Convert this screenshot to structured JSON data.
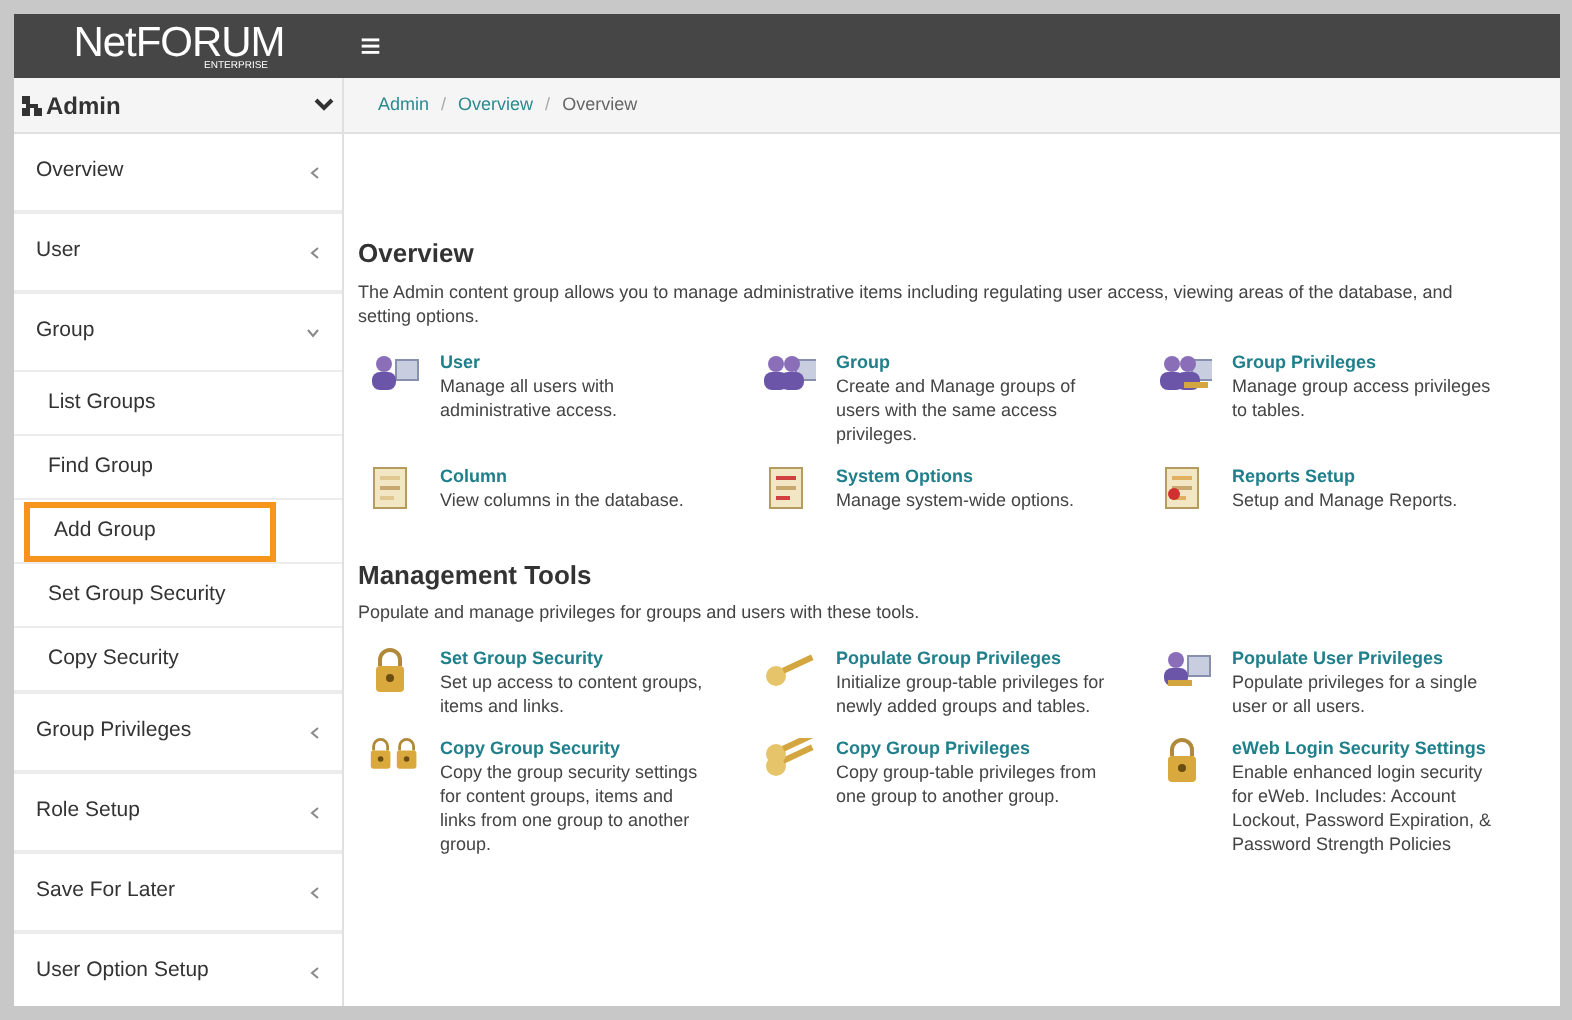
{
  "header": {
    "logo": "NetFORUM",
    "logo_sub": "ENTERPRISE",
    "menu_glyph": "≡"
  },
  "sidebar": {
    "title": "Admin",
    "items": [
      {
        "label": "Overview",
        "expanded": false
      },
      {
        "label": "User",
        "expanded": false
      },
      {
        "label": "Group",
        "expanded": true,
        "children": [
          {
            "label": "List Groups",
            "highlighted": false
          },
          {
            "label": "Find Group",
            "highlighted": false
          },
          {
            "label": "Add Group",
            "highlighted": true
          },
          {
            "label": "Set Group Security",
            "highlighted": false
          },
          {
            "label": "Copy Security",
            "highlighted": false
          }
        ]
      },
      {
        "label": "Group Privileges",
        "expanded": false
      },
      {
        "label": "Role Setup",
        "expanded": false
      },
      {
        "label": "Save For Later",
        "expanded": false
      },
      {
        "label": "User Option Setup",
        "expanded": false
      }
    ]
  },
  "breadcrumb": [
    "Admin",
    "Overview",
    "Overview"
  ],
  "breadcrumb_separator": "/",
  "sections": [
    {
      "title": "Overview",
      "intro": "The Admin content group allows you to manage administrative items including regulating user access, viewing areas of the database, and setting options.",
      "tools": [
        {
          "title": "User",
          "text": "Manage all users with administrative access."
        },
        {
          "title": "Group",
          "text": "Create and Manage groups of users with the same access privileges."
        },
        {
          "title": "Group Privileges",
          "text": "Manage group access privileges to tables."
        },
        {
          "title": "Column",
          "text": "View columns in the database."
        },
        {
          "title": "System Options",
          "text": "Manage system-wide options."
        },
        {
          "title": "Reports Setup",
          "text": "Setup and Manage Reports."
        }
      ]
    },
    {
      "title": "Management Tools",
      "intro": "Populate and manage privileges for groups and users with these tools.",
      "tools": [
        {
          "title": "Set Group Security",
          "text": "Set up access to content groups, items and links."
        },
        {
          "title": "Populate Group Privileges",
          "text": "Initialize group-table privileges for newly added groups and tables."
        },
        {
          "title": "Populate User Privileges",
          "text": "Populate privileges for a single user or all users."
        },
        {
          "title": "Copy Group Security",
          "text": "Copy the group security settings for content groups, items and links from one group to another group."
        },
        {
          "title": "Copy Group Privileges",
          "text": "Copy group-table privileges from one group to another group."
        },
        {
          "title": "eWeb Login Security Settings",
          "text": "Enable enhanced login security for eWeb. Includes: Account Lockout, Password Expiration, & Password Strength Policies"
        }
      ]
    }
  ]
}
